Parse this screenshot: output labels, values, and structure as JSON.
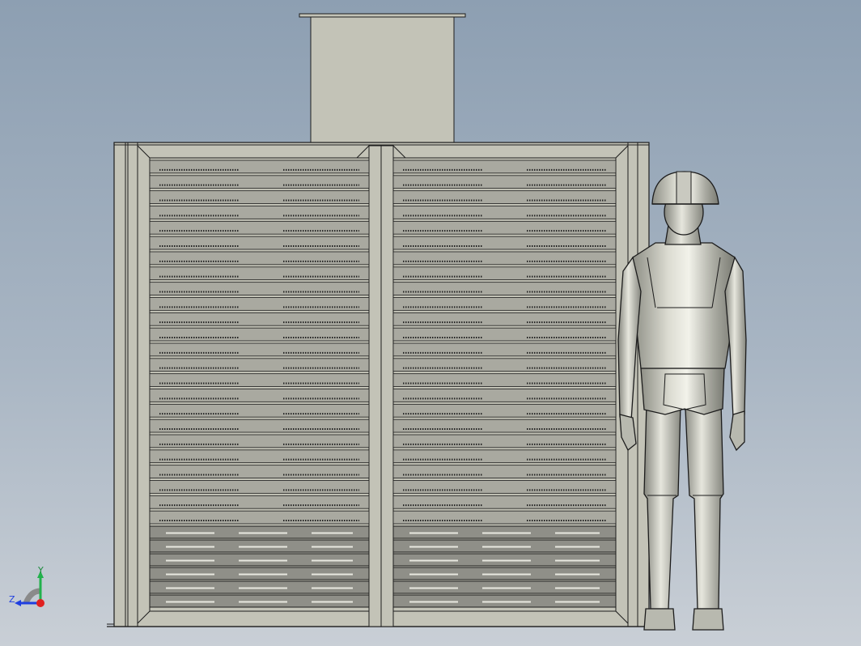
{
  "view": {
    "background_top": "#8d9fb2",
    "background_bottom": "#c9cfd6"
  },
  "model": {
    "enclosure_color": "#c3c3b7",
    "louver_color": "#a9a9a0",
    "edge_color": "#1c1c1c",
    "person_color": "#b5b7ad",
    "louver_rows_upper": 24,
    "louver_rows_lower": 6
  },
  "triad": {
    "y_label": "Y",
    "z_label": "Z",
    "y_axis_color": "#22b14c",
    "z_axis_color": "#1f3fe0",
    "x_axis_color": "#e02020"
  }
}
